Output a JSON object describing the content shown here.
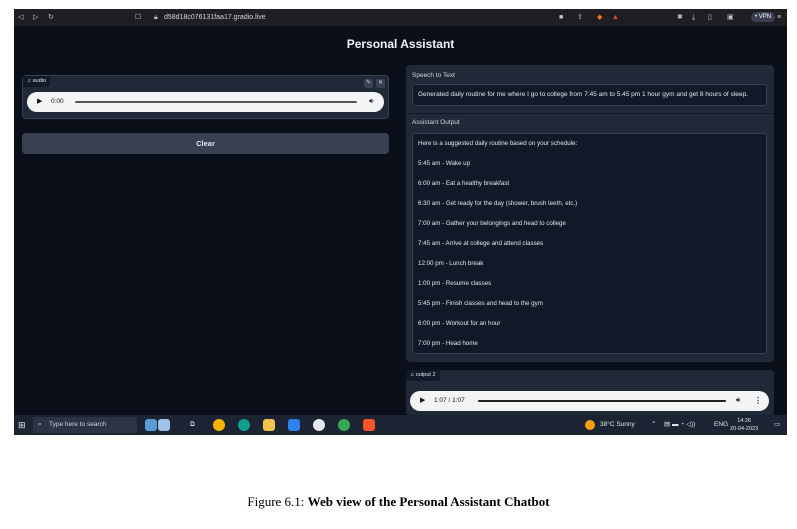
{
  "browser": {
    "url": "d58d18c076131faa17.gradio.live",
    "vpn_label": "• VPN"
  },
  "app": {
    "title": "Personal Assistant",
    "audio_input": {
      "label": "audio",
      "time": "0:00"
    },
    "clear_label": "Clear",
    "speech_to_text": {
      "label": "Speech to Text",
      "value": "Generated daily routine for me where I go to college from 7.45 am to 5.45 pm 1 hour gym and get 8 hours of sleep."
    },
    "assistant_output": {
      "label": "Assistant Output",
      "lines": [
        "Here is a suggested daily routine based on your schedule:",
        "5:45 am - Wake up",
        "6:00 am - Eat a healthy breakfast",
        "6:30 am - Get ready for the day (shower, brush teeth, etc.)",
        "7:00 am - Gather your belongings and head to college",
        "7:45 am - Arrive at college and attend classes",
        "12:00 pm - Lunch break",
        "1:00 pm - Resume classes",
        "5:45 pm - Finish classes and head to the gym",
        "6:00 pm - Workout for an hour",
        "7:00 pm - Head home"
      ]
    },
    "audio_output": {
      "label": "output 2",
      "time": "1:07 / 1:07",
      "progress": 1.0
    }
  },
  "taskbar": {
    "search_placeholder": "Type here to search",
    "weather": "38°C  Sunny",
    "lang": "ENG",
    "time": "14:26",
    "date": "20-04-2023"
  },
  "caption": {
    "prefix": "Figure 6.1: ",
    "title": "Web view of the Personal Assistant Chatbot"
  }
}
